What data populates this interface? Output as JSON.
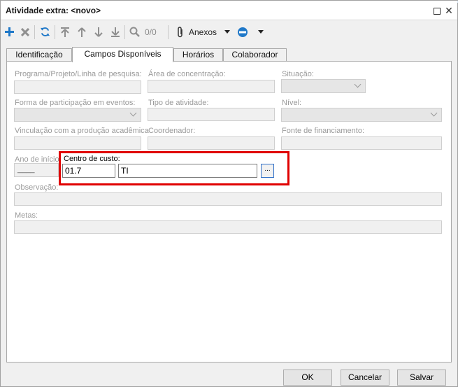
{
  "window": {
    "title": "Atividade extra: <novo>",
    "maximize_glyph": "",
    "close_glyph": "✕"
  },
  "toolbar": {
    "count": "0/0",
    "anexos_label": "Anexos",
    "icons": [
      "plus-icon",
      "delete-icon",
      "refresh-icon",
      "first-icon",
      "up-icon",
      "down-icon",
      "last-icon",
      "search-icon",
      "paperclip-icon",
      "cancel-icon"
    ]
  },
  "tabs": [
    {
      "label": "Identificação",
      "active": false
    },
    {
      "label": "Campos Disponíveis",
      "active": true
    },
    {
      "label": "Horários",
      "active": false
    },
    {
      "label": "Colaborador",
      "active": false
    }
  ],
  "form": {
    "programa_label": "Programa/Projeto/Linha de pesquisa:",
    "area_label": "Área de concentração:",
    "situacao_label": "Situação:",
    "forma_label": "Forma de participação em eventos:",
    "tipo_label": "Tipo de atividade:",
    "nivel_label": "Nível:",
    "vinculacao_label": "Vinculação com a produção acadêmica",
    "coordenador_label": "Coordenador:",
    "fonte_label": "Fonte de financiamento:",
    "ano_label": "Ano de início:",
    "ano_value": "____",
    "centro_label": "Centro de custo:",
    "centro_code": "01.7",
    "centro_name": "TI",
    "lookup_label": "...",
    "observacao_label": "Observação:",
    "metas_label": "Metas:"
  },
  "footer": {
    "ok": "OK",
    "cancel": "Cancelar",
    "save": "Salvar"
  },
  "colors": {
    "highlight": "#e00000",
    "add_icon": "#1f78c8",
    "accent_border": "#2f6fc7"
  }
}
